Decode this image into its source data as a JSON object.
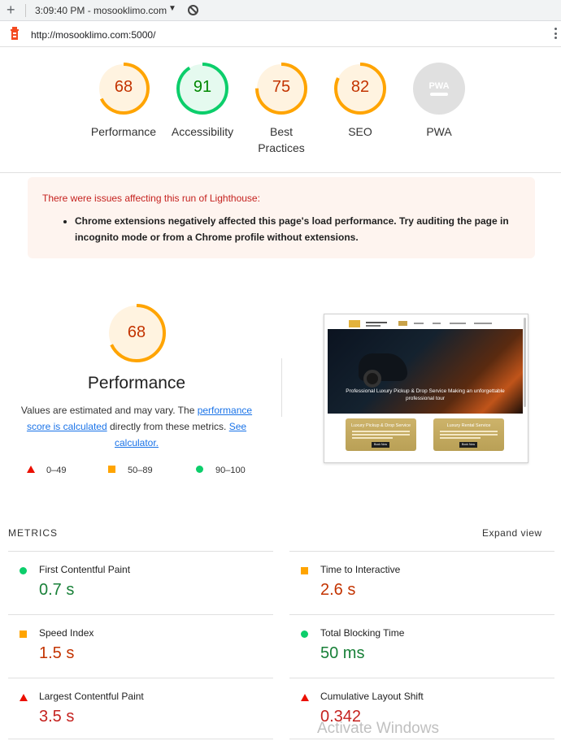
{
  "topbar": {
    "new_tab_symbol": "+",
    "title": "3:09:40 PM - mosooklimo.com",
    "caret": "▼"
  },
  "urlbar": {
    "url": "http://mosooklimo.com:5000/"
  },
  "gauges": [
    {
      "label_line1": "Performance",
      "label_line2": "",
      "value": "68",
      "score": 68,
      "color": "#ffa400",
      "text_color": "#c33300",
      "bg": "#fff3e0"
    },
    {
      "label_line1": "Accessibility",
      "label_line2": "",
      "value": "91",
      "score": 91,
      "color": "#0cce6b",
      "text_color": "#008800",
      "bg": "#e5faef"
    },
    {
      "label_line1": "Best",
      "label_line2": "Practices",
      "value": "75",
      "score": 75,
      "color": "#ffa400",
      "text_color": "#c33300",
      "bg": "#fff3e0"
    },
    {
      "label_line1": "SEO",
      "label_line2": "",
      "value": "82",
      "score": 82,
      "color": "#ffa400",
      "text_color": "#c33300",
      "bg": "#fff3e0"
    }
  ],
  "pwa": {
    "badge": "PWA",
    "label": "PWA"
  },
  "warning": {
    "title": "There were issues affecting this run of Lighthouse:",
    "item": "Chrome extensions negatively affected this page's load performance. Try auditing the page in incognito mode or from a Chrome profile without extensions."
  },
  "performance": {
    "score": "68",
    "score_fraction": 0.68,
    "title": "Performance",
    "desc_prefix": "Values are estimated and may vary. The ",
    "desc_link1": "performance score is calculated",
    "desc_mid": " directly from these metrics. ",
    "desc_link2": "See calculator."
  },
  "legend": {
    "fail": "0–49",
    "average": "50–89",
    "pass": "90–100"
  },
  "thumbnail": {
    "hero_text": "Professional Luxury Pickup & Drop Service Making an unforgettable professional tour",
    "card1_title": "Luxury Pickup & Drop Service",
    "card2_title": "Luxury Rental Service",
    "card_button": "Book Now"
  },
  "metrics": {
    "header": "METRICS",
    "expand": "Expand view",
    "items": [
      {
        "name": "First Contentful Paint",
        "value": "0.7 s",
        "status": "pass"
      },
      {
        "name": "Time to Interactive",
        "value": "2.6 s",
        "status": "average"
      },
      {
        "name": "Speed Index",
        "value": "1.5 s",
        "status": "average"
      },
      {
        "name": "Total Blocking Time",
        "value": "50 ms",
        "status": "pass"
      },
      {
        "name": "Largest Contentful Paint",
        "value": "3.5 s",
        "status": "fail"
      },
      {
        "name": "Cumulative Layout Shift",
        "value": "0.342",
        "status": "fail"
      }
    ]
  },
  "watermark": "Activate Windows"
}
